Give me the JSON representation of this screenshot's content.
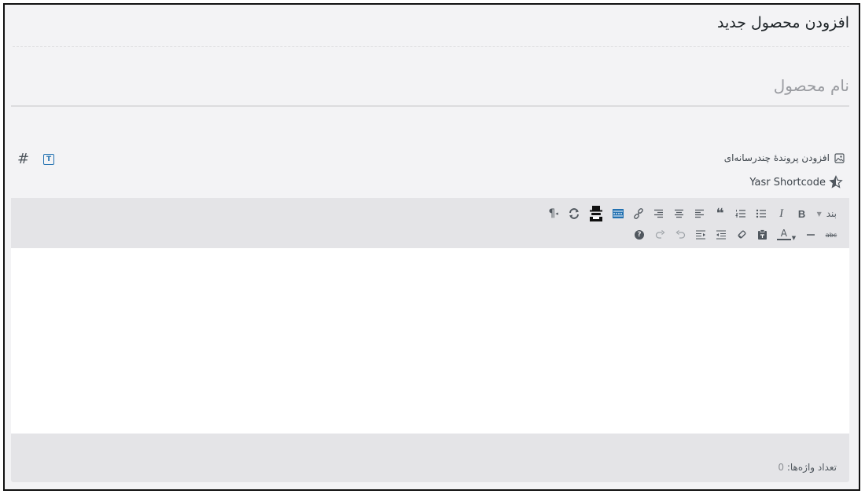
{
  "page": {
    "title": "افزودن محصول جدید"
  },
  "product_name": {
    "placeholder": "نام محصول",
    "value": ""
  },
  "media": {
    "add_media_label": "افزودن پروندهٔ چندرسانه‌ای",
    "icon": "media-icon"
  },
  "tabs": {
    "hash_icon": "#",
    "text_tab_letter": "T"
  },
  "yasr": {
    "label": "Yasr Shortcode",
    "icon": "star-half-icon"
  },
  "toolbar": {
    "format_select": "بند",
    "row1": [
      "bold",
      "italic",
      "bulleted-list",
      "numbered-list",
      "blockquote",
      "align-left",
      "align-center",
      "align-right",
      "insert-link",
      "read-more",
      "spy-icon",
      "refresh-icon",
      "paragraph-rtl"
    ],
    "row2": [
      "strikethrough",
      "horizontal-line",
      "text-color",
      "paste-as-text",
      "clear-formatting",
      "outdent",
      "indent",
      "undo",
      "redo",
      "help"
    ],
    "bold_glyph": "B",
    "italic_glyph": "I",
    "quote_glyph": "❝",
    "paragraph_glyph": "¶",
    "text_color_glyph": "A",
    "strike_glyph": "abc",
    "help_glyph": "?"
  },
  "status": {
    "word_count_label": "تعداد واژه‌ها:",
    "word_count": "0"
  },
  "colors": {
    "accent": "#2271b1",
    "toolbar_bg": "#e4e4e7",
    "panel_bg": "#f3f3f5"
  }
}
